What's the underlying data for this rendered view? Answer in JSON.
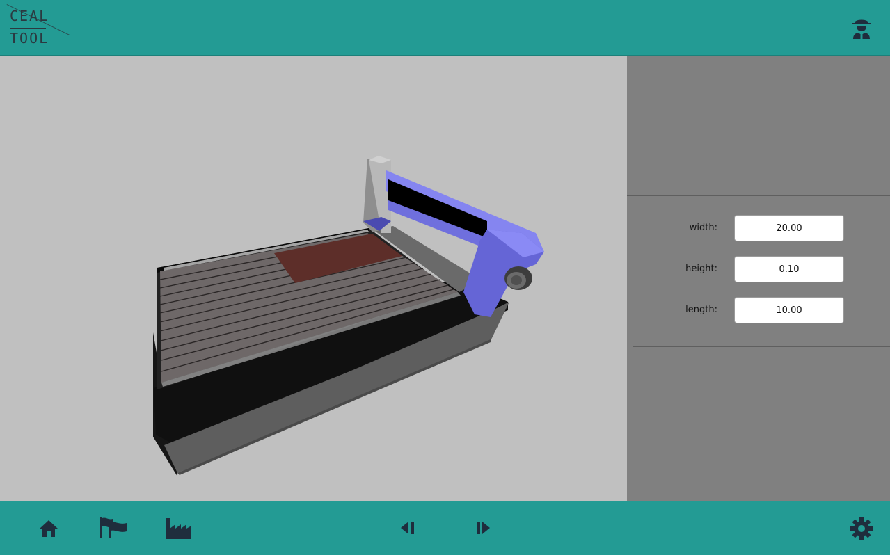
{
  "app": {
    "logo_line1": "CEAL",
    "logo_line2": "TOOL",
    "header_color": "#239b94",
    "icon_color": "#1f2d3d"
  },
  "header": {
    "user_icon": "worker-avatar-icon"
  },
  "viewport": {
    "background": "#c0c0c0",
    "model": "cnc-machine-3d",
    "gantry_color": "#7777e6",
    "workpiece_color": "#5d2e29"
  },
  "params": {
    "width": {
      "label": "width:",
      "value": "20.00"
    },
    "height": {
      "label": "height:",
      "value": "0.10"
    },
    "length": {
      "label": "length:",
      "value": "10.00"
    }
  },
  "footer": {
    "icons": [
      "home-icon",
      "flags-icon",
      "factory-icon",
      "step-back-icon",
      "step-forward-icon",
      "gear-icon"
    ]
  }
}
